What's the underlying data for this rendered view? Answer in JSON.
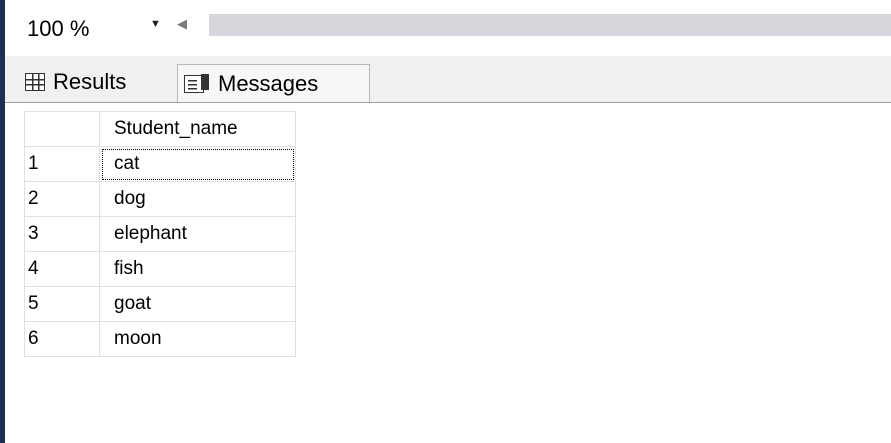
{
  "zoom": {
    "value": "100 %"
  },
  "tabs": [
    {
      "label": "Results"
    },
    {
      "label": "Messages"
    }
  ],
  "results": {
    "columns": [
      "Student_name"
    ],
    "rows": [
      {
        "num": "1",
        "Student_name": "cat"
      },
      {
        "num": "2",
        "Student_name": "dog"
      },
      {
        "num": "3",
        "Student_name": "elephant"
      },
      {
        "num": "4",
        "Student_name": "fish"
      },
      {
        "num": "5",
        "Student_name": "goat"
      },
      {
        "num": "6",
        "Student_name": "moon"
      }
    ]
  },
  "colors": {
    "accent_bar": "#1e2e57",
    "scroll_track": "#d6d7dc",
    "tab_bar": "#f0f0f0"
  },
  "icons": {
    "results_tab": "grid-icon",
    "messages_tab": "messages-icon",
    "zoom_dropdown": "chevron-down-icon",
    "scroll_left": "scroll-left-arrow-icon"
  }
}
